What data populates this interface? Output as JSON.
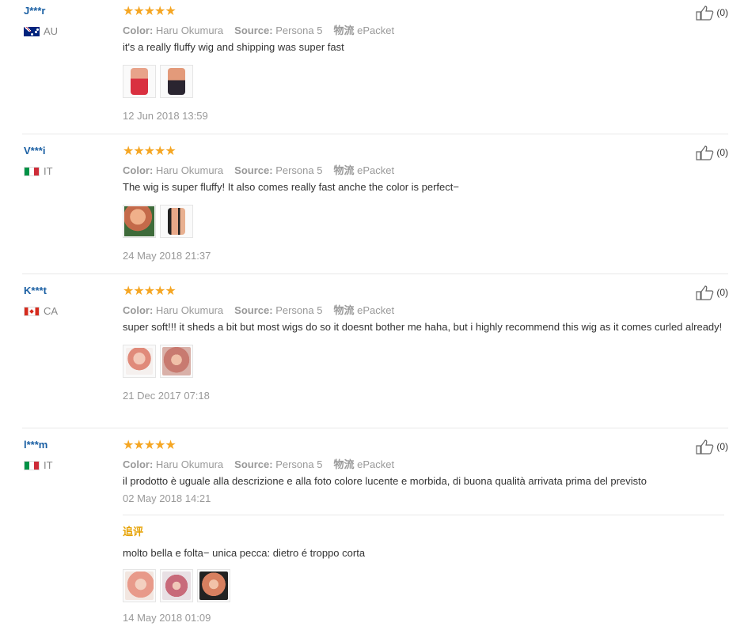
{
  "labels": {
    "color": "Color:",
    "source": "Source:",
    "shipping": "物流",
    "helpful_count": "(0)",
    "follow_up": "追评"
  },
  "colors": {
    "star": "#f5a623",
    "username": "#1a5fa3",
    "followup_label": "#e6a100"
  },
  "reviews": [
    {
      "user": "J***r",
      "country": "AU",
      "flag": "au-flag-icon",
      "stars": "★★★★★",
      "rating": 5,
      "color_value": "Haru Okumura",
      "source_value": "Persona 5",
      "shipping_value": "ePacket",
      "text": "it's a really fluffy wig and shipping was super fast",
      "photo_count": 2,
      "date": "12 Jun 2018 13:59"
    },
    {
      "user": "V***i",
      "country": "IT",
      "flag": "it-flag-icon",
      "stars": "★★★★★",
      "rating": 5,
      "color_value": "Haru Okumura",
      "source_value": "Persona 5",
      "shipping_value": "ePacket",
      "text": "The wig is super fluffy! It also comes really fast anche the color is perfect−",
      "photo_count": 2,
      "date": "24 May 2018 21:37"
    },
    {
      "user": "K***t",
      "country": "CA",
      "flag": "ca-flag-icon",
      "stars": "★★★★★",
      "rating": 5,
      "color_value": "Haru Okumura",
      "source_value": "Persona 5",
      "shipping_value": "ePacket",
      "text": "super soft!!! it sheds a bit but most wigs do so it doesnt bother me haha, but i highly recommend this wig as it comes curled already!",
      "photo_count": 2,
      "date": "21 Dec 2017 07:18"
    },
    {
      "user": "l***m",
      "country": "IT",
      "flag": "it-flag-icon",
      "stars": "★★★★★",
      "rating": 5,
      "color_value": "Haru Okumura",
      "source_value": "Persona 5",
      "shipping_value": "ePacket",
      "text": "il prodotto è uguale alla descrizione e alla foto colore lucente e morbida, di buona qualità arrivata prima del previsto",
      "date": "02 May 2018 14:21",
      "followup_text": "molto bella e folta− unica pecca: dietro é troppo corta",
      "followup_photo_count": 3,
      "followup_date": "14 May 2018 01:09"
    }
  ]
}
